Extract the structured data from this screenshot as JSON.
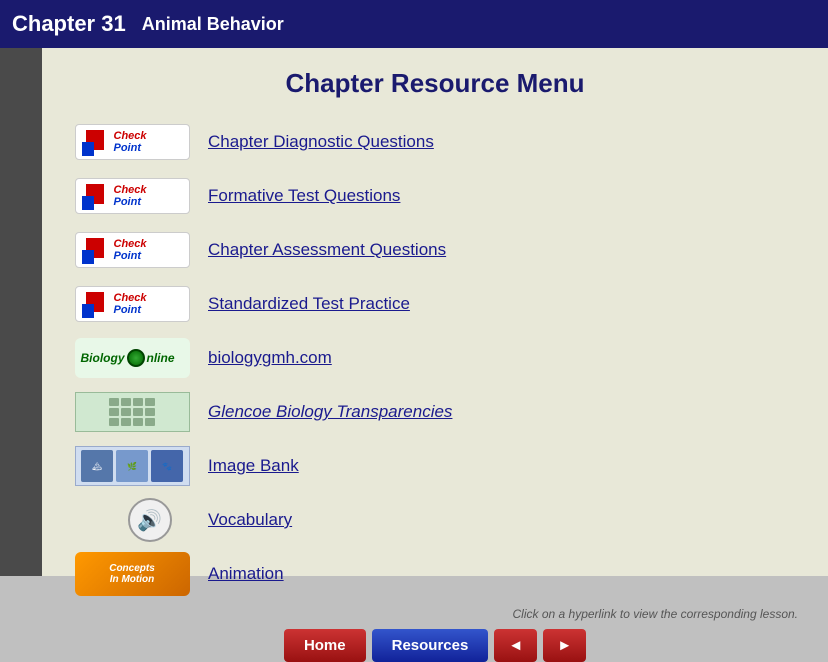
{
  "header": {
    "chapter": "Chapter 31",
    "title": "Animal Behavior"
  },
  "menu": {
    "title": "Chapter Resource Menu",
    "items": [
      {
        "id": "diagnostic",
        "label": "Chapter Diagnostic Questions",
        "icon_type": "checkpoint",
        "italic": false
      },
      {
        "id": "formative",
        "label": "Formative Test Questions",
        "icon_type": "checkpoint",
        "italic": false
      },
      {
        "id": "assessment",
        "label": "Chapter Assessment Questions",
        "icon_type": "checkpoint",
        "italic": false
      },
      {
        "id": "standardized",
        "label": "Standardized Test Practice",
        "icon_type": "checkpoint",
        "italic": false
      },
      {
        "id": "biology",
        "label": "biologygmh.com",
        "icon_type": "biology_online",
        "italic": false
      },
      {
        "id": "transparencies",
        "label": "Glencoe Biology Transparencies",
        "icon_type": "transparencies",
        "italic": true
      },
      {
        "id": "imagebank",
        "label": "Image Bank",
        "icon_type": "imagebank",
        "italic": false
      },
      {
        "id": "vocabulary",
        "label": "Vocabulary",
        "icon_type": "vocabulary",
        "italic": false
      },
      {
        "id": "animation",
        "label": "Animation",
        "icon_type": "animation",
        "italic": false
      }
    ]
  },
  "footer": {
    "click_note": "Click on a hyperlink to view the corresponding lesson.",
    "buttons": {
      "home": "Home",
      "resources": "Resources",
      "prev": "◄",
      "next": "►"
    }
  },
  "colors": {
    "header_bg": "#1a1a6e",
    "content_bg": "#e8e8d8",
    "link_color": "#1a1a8e",
    "title_color": "#1a1a6e"
  }
}
